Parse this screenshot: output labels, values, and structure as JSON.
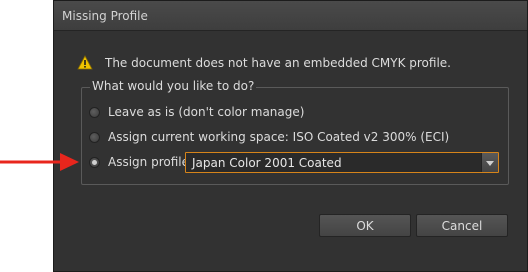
{
  "dialog": {
    "title": "Missing Profile",
    "message": "The document does not have an embedded CMYK profile.",
    "group_label": "What would you like to do?",
    "options": [
      {
        "label": "Leave as is (don't color manage)",
        "selected": false
      },
      {
        "label": "Assign current working space: ISO Coated v2 300% (ECI)",
        "selected": false
      },
      {
        "label": "Assign profile:",
        "selected": true
      }
    ],
    "profile_select": {
      "value": "Japan Color 2001 Coated"
    },
    "ok_label": "OK",
    "cancel_label": "Cancel"
  },
  "icons": {
    "warning": "warning-icon",
    "dropdown": "chevron-down-icon",
    "annotation": "red-arrow-icon"
  },
  "colors": {
    "dialog_bg": "#323232",
    "focus_border": "#d6841a",
    "warning_fill": "#f0c400",
    "annotation_arrow": "#e8261d"
  }
}
